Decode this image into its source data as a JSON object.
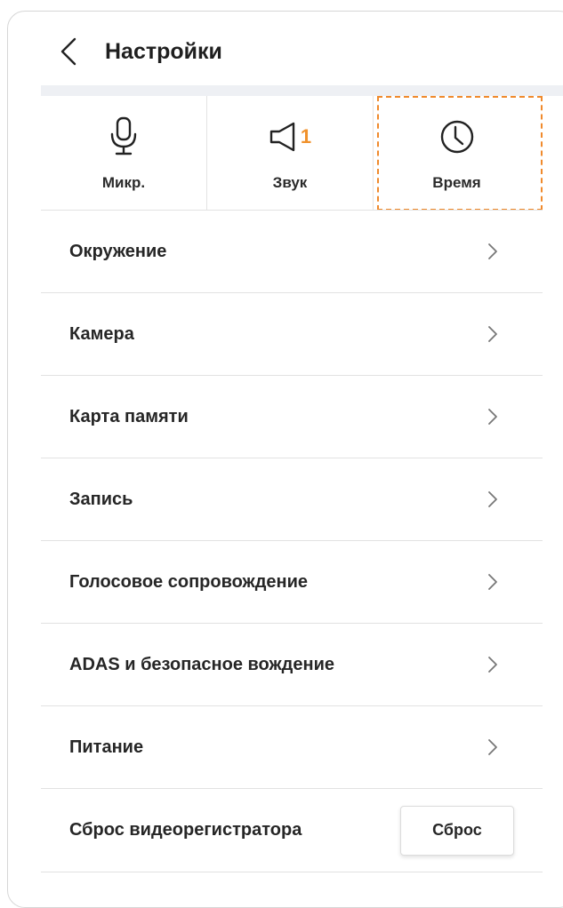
{
  "header": {
    "title": "Настройки",
    "back_icon": "chevron-left-icon"
  },
  "tabs": [
    {
      "label": "Микр.",
      "icon": "microphone-icon"
    },
    {
      "label": "Звук",
      "icon": "speaker-icon",
      "badge": "1"
    },
    {
      "label": "Время",
      "icon": "clock-icon",
      "selected": true
    }
  ],
  "menu": [
    {
      "label": "Окружение"
    },
    {
      "label": "Камера"
    },
    {
      "label": "Карта памяти"
    },
    {
      "label": "Запись"
    },
    {
      "label": "Голосовое сопровождение"
    },
    {
      "label": "ADAS и безопасное вождение"
    },
    {
      "label": "Питание"
    }
  ],
  "reset": {
    "label": "Сброс видеорегистратора",
    "button_label": "Сброс"
  },
  "colors": {
    "accent": "#f08a2c",
    "divider": "#e2e2e2"
  }
}
